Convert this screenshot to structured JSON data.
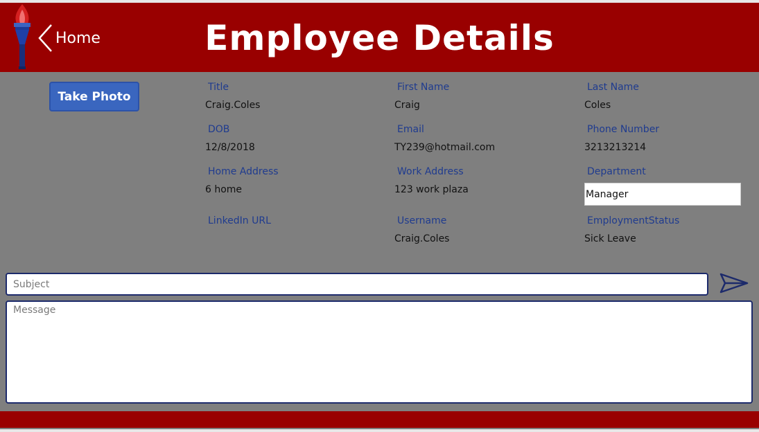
{
  "header": {
    "back_label": "Home",
    "title": "Employee Details"
  },
  "actions": {
    "take_photo_label": "Take Photo"
  },
  "fields": [
    {
      "label": "Title",
      "value": "Craig.Coles"
    },
    {
      "label": "First Name",
      "value": "Craig"
    },
    {
      "label": "Last Name",
      "value": "Coles"
    },
    {
      "label": "DOB",
      "value": "12/8/2018"
    },
    {
      "label": "Email",
      "value": "TY239@hotmail.com"
    },
    {
      "label": "Phone Number",
      "value": "3213213214"
    },
    {
      "label": "Home Address",
      "value": "6 home"
    },
    {
      "label": "Work Address",
      "value": "123 work plaza"
    },
    {
      "label": "Department",
      "value": "Manager"
    },
    {
      "label": "LinkedIn URL",
      "value": ""
    },
    {
      "label": "Username",
      "value": "Craig.Coles"
    },
    {
      "label": "EmploymentStatus",
      "value": "Sick Leave"
    }
  ],
  "compose": {
    "subject_placeholder": "Subject",
    "subject_value": "",
    "message_placeholder": "Message",
    "message_value": ""
  },
  "icons": {
    "logo": "torch-icon",
    "back": "chevron-left-icon",
    "send": "send-icon"
  },
  "colors": {
    "header_bg": "#990000",
    "body_bg": "#7f7f7f",
    "button_bg": "#3a66bf",
    "label_color": "#1f3b8f",
    "border_dark": "#1c2a6b"
  }
}
